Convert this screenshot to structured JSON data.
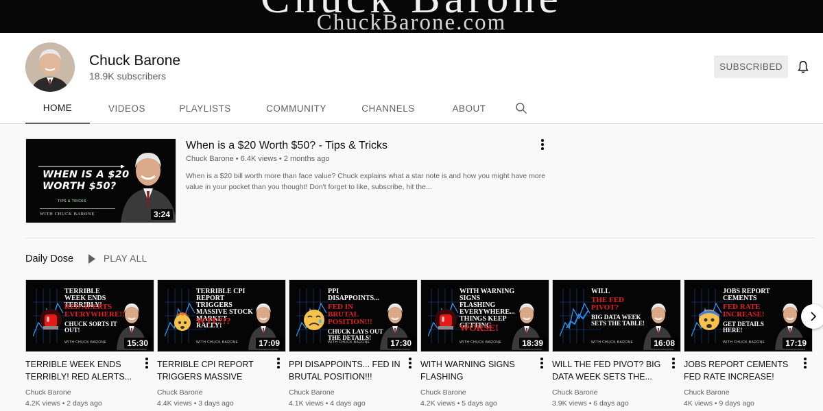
{
  "banner": {
    "brand": "Chuck Barone",
    "url": "ChuckBarone.com"
  },
  "channel": {
    "name": "Chuck Barone",
    "subscribers": "18.9K subscribers",
    "subscribe_label": "SUBSCRIBED"
  },
  "tabs": [
    "HOME",
    "VIDEOS",
    "PLAYLISTS",
    "COMMUNITY",
    "CHANNELS",
    "ABOUT"
  ],
  "featured": {
    "thumb_line1": "WHEN IS A $20",
    "thumb_line2": "WORTH $50?",
    "thumb_tag": "TIPS & TRICKS",
    "thumb_with": "WITH CHUCK BARONE",
    "duration": "3:24",
    "title": "When is a $20 Worth $50? - Tips & Tricks",
    "meta": "Chuck Barone • 6.4K views • 2 months ago",
    "description": "When is a $20 bill worth more than face value? Chuck explains what a star note is and how you might have more value in your pocket than you thought! Don't forget to like, subscribe, hit the..."
  },
  "shelf": {
    "title": "Daily Dose",
    "play_all": "PLAY ALL",
    "videos": [
      {
        "h1": "TERRIBLE WEEK ENDS TERRIBLY!",
        "h2": "RED ALERTS EVERYWHERE!!!",
        "h3": "CHUCK SORTS IT OUT!",
        "with": "WITH CHUCK BARONE",
        "icon": "siren-icon",
        "duration": "15:30",
        "title": "TERRIBLE WEEK ENDS TERRIBLY! RED ALERTS...",
        "channel": "Chuck Barone",
        "meta": "4.2K views • 2 days ago"
      },
      {
        "h1": "TERRIBLE CPI REPORT TRIGGERS MASSIVE STOCK MARKET RALLY!",
        "h2": "WTF?!?",
        "h3": "",
        "with": "WITH CHUCK BARONE",
        "icon": "exploding-head-icon",
        "duration": "17:09",
        "title": "TERRIBLE CPI REPORT TRIGGERS MASSIVE STOC...",
        "channel": "Chuck Barone",
        "meta": "4.4K views • 3 days ago"
      },
      {
        "h1": "PPI DISAPPOINTS...",
        "h2": "FED IN BRUTAL POSITION!!!",
        "h3": "CHUCK LAYS OUT THE DETAILS!",
        "with": "WITH CHUCK BARONE",
        "icon": "sad-face-icon",
        "duration": "17:30",
        "title": "PPI DISAPPOINTS... FED IN BRUTAL POSITION!!! Chuck...",
        "channel": "Chuck Barone",
        "meta": "4.1K views • 4 days ago"
      },
      {
        "h1": "WITH WARNING SIGNS FLASHING EVERYWHERE... THINGS KEEP GETTING",
        "h2": "WORSE!",
        "h3": "",
        "with": "WITH CHUCK BARONE",
        "icon": "siren-icon",
        "duration": "18:39",
        "title": "WITH WARNING SIGNS FLASHING EVERYWHERE.....",
        "channel": "Chuck Barone",
        "meta": "4.2K views • 5 days ago"
      },
      {
        "h1": "WILL",
        "h2": "THE FED PIVOT?",
        "h3": "BIG DATA WEEK SETS THE TABLE!",
        "with": "WITH CHUCK BARONE",
        "icon": "chart-icon",
        "duration": "16:08",
        "title": "WILL THE FED PIVOT? BIG DATA WEEK SETS THE...",
        "channel": "Chuck Barone",
        "meta": "3.9K views • 6 days ago"
      },
      {
        "h1": "JOBS REPORT CEMENTS",
        "h2": "FED RATE INCREASE!",
        "h3": "GET DETAILS HERE!",
        "with": "WITH CHUCK BARONE",
        "icon": "scared-face-icon",
        "duration": "17:19",
        "title": "JOBS REPORT CEMENTS FED RATE INCREASE! GET...",
        "channel": "Chuck Barone",
        "meta": "4K views • 9 days ago"
      }
    ]
  },
  "colors": {
    "accent_red": "#e02020",
    "text_secondary": "#606060",
    "banner_bg": "#070707"
  }
}
